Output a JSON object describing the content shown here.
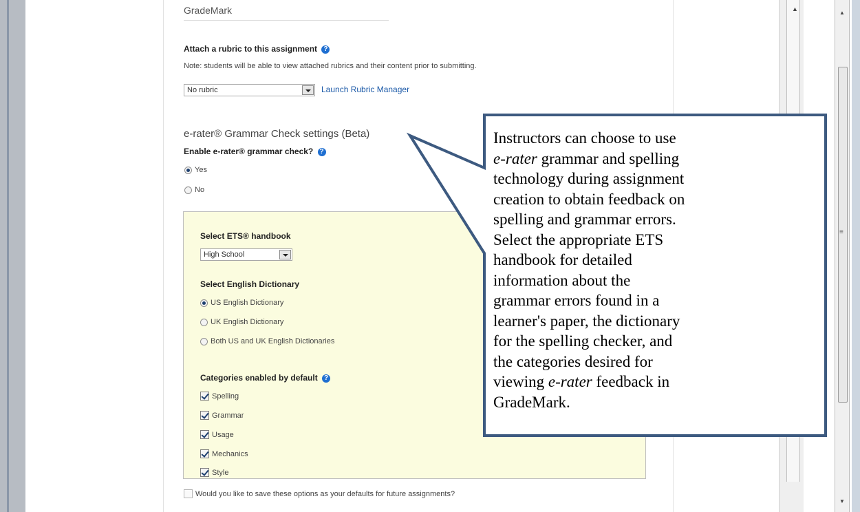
{
  "gradebook_section": {
    "title": "GradeMark"
  },
  "rubric": {
    "heading": "Attach a rubric to this assignment",
    "note": "Note: students will be able to view attached rubrics and their content prior to submitting.",
    "select_value": "No rubric",
    "manager_link": "Launch Rubric Manager"
  },
  "erater": {
    "title": "e-rater® Grammar Check settings (Beta)",
    "enable_label": "Enable e-rater® grammar check?",
    "options": [
      {
        "label": "Yes",
        "selected": true
      },
      {
        "label": "No",
        "selected": false
      }
    ]
  },
  "handbook": {
    "label": "Select ETS® handbook",
    "value": "High School"
  },
  "dictionary": {
    "label": "Select English Dictionary",
    "options": [
      {
        "label": "US English Dictionary",
        "selected": true
      },
      {
        "label": "UK English Dictionary",
        "selected": false
      },
      {
        "label": "Both US and UK English Dictionaries",
        "selected": false
      }
    ]
  },
  "categories": {
    "label": "Categories enabled by default",
    "items": [
      {
        "label": "Spelling",
        "checked": true
      },
      {
        "label": "Grammar",
        "checked": true
      },
      {
        "label": "Usage",
        "checked": true
      },
      {
        "label": "Mechanics",
        "checked": true
      },
      {
        "label": "Style",
        "checked": true
      }
    ]
  },
  "save_defaults": {
    "label": "Would you like to save these options as your defaults for future assignments?",
    "checked": false
  },
  "callout": {
    "p1": "Instructors can choose to use ",
    "em1": "e-rater",
    "p2": " grammar and spelling technology during assignment creation to obtain feedback on spelling and grammar errors. Select the appropriate ETS handbook for detailed information about the grammar errors found in a learner's paper, the dictionary for the spelling checker, and the categories desired for viewing ",
    "em2": "e-rater",
    "p3": " feedback in GradeMark."
  },
  "icons": {
    "help": "question-circle-icon",
    "dropdown": "chevron-down-icon"
  },
  "colors": {
    "callout_border": "#3d5a80",
    "link": "#1c5aa8",
    "panel_bg": "#fbfcdf",
    "help_icon": "#1f6fd1"
  }
}
